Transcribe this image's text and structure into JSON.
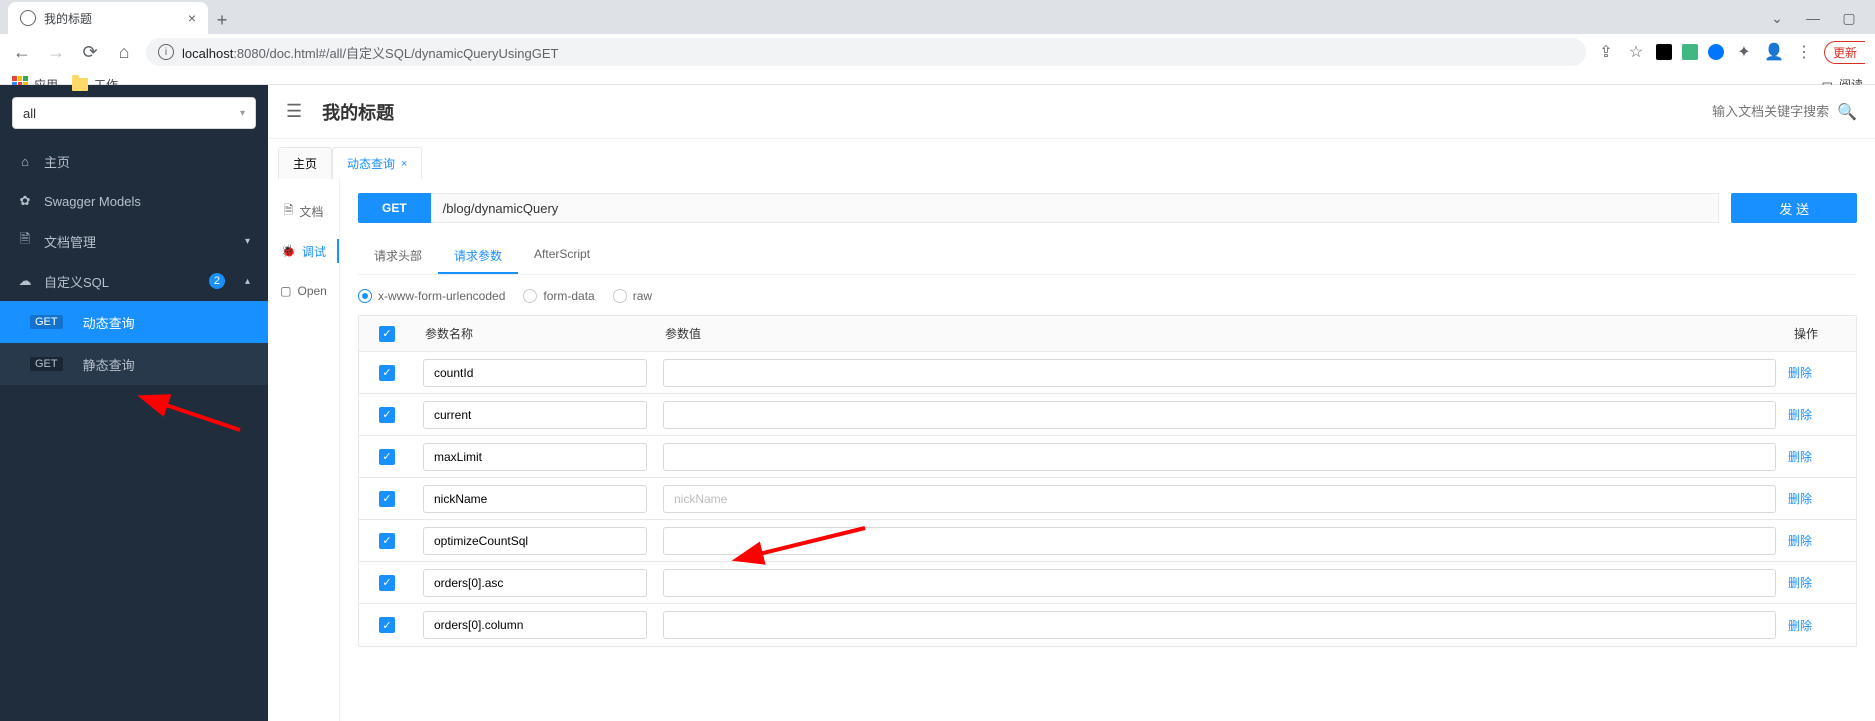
{
  "browser": {
    "tab_title": "我的标题",
    "url_host": "localhost",
    "url_port": ":8080",
    "url_path": "/doc.html#/all/自定义SQL/dynamicQueryUsingGET",
    "refresh_label": "更新",
    "bookmarks": {
      "apps": "应用",
      "work": "工作",
      "reading": "阅读"
    }
  },
  "sidebar": {
    "group": "all",
    "items": {
      "home": "主页",
      "swagger": "Swagger Models",
      "docmgr": "文档管理",
      "customsql": "自定义SQL",
      "customsql_badge": "2"
    },
    "children": [
      {
        "method": "GET",
        "label": "动态查询",
        "active": true
      },
      {
        "method": "GET",
        "label": "静态查询",
        "active": false
      }
    ]
  },
  "header": {
    "title": "我的标题",
    "search_placeholder": "输入文档关键字搜索"
  },
  "tabs": {
    "home": "主页",
    "dynamic": "动态查询"
  },
  "rail": {
    "doc": "文档",
    "debug": "调试",
    "open": "Open"
  },
  "debug": {
    "method": "GET",
    "path": "/blog/dynamicQuery",
    "send": "发 送",
    "subtabs": {
      "headers": "请求头部",
      "params": "请求参数",
      "afterscript": "AfterScript"
    },
    "bodytypes": {
      "urlencoded": "x-www-form-urlencoded",
      "formdata": "form-data",
      "raw": "raw"
    },
    "table": {
      "head_name": "参数名称",
      "head_value": "参数值",
      "head_action": "操作",
      "delete": "删除",
      "rows": [
        {
          "name": "countId",
          "value": "",
          "placeholder": ""
        },
        {
          "name": "current",
          "value": "",
          "placeholder": ""
        },
        {
          "name": "maxLimit",
          "value": "",
          "placeholder": ""
        },
        {
          "name": "nickName",
          "value": "",
          "placeholder": "nickName"
        },
        {
          "name": "optimizeCountSql",
          "value": "",
          "placeholder": ""
        },
        {
          "name": "orders[0].asc",
          "value": "",
          "placeholder": ""
        },
        {
          "name": "orders[0].column",
          "value": "",
          "placeholder": ""
        }
      ]
    }
  }
}
